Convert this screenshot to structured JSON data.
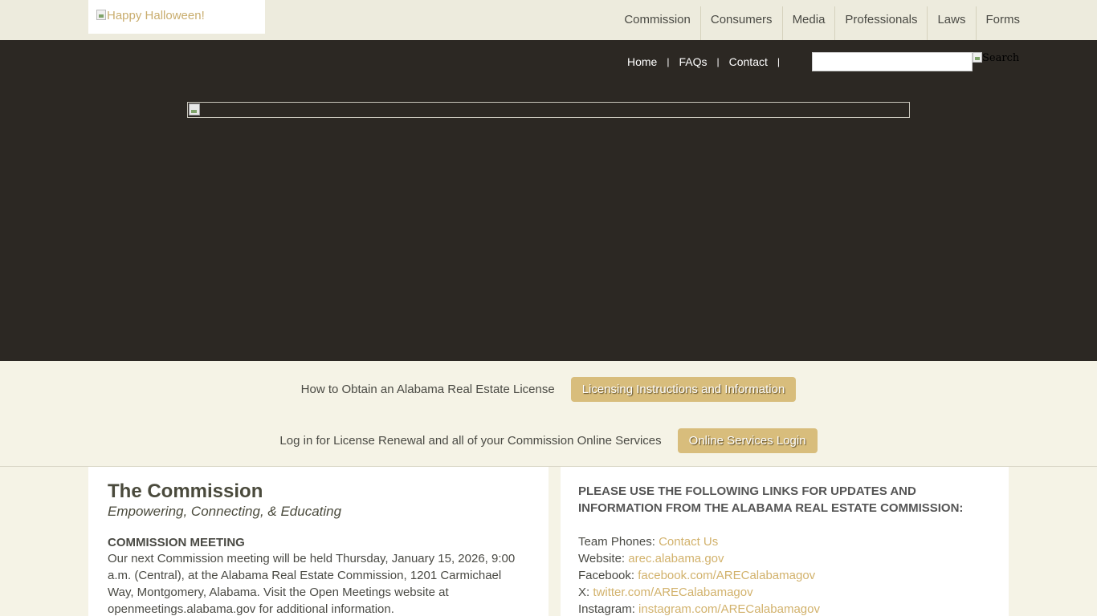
{
  "header": {
    "logo_alt": "Happy Halloween!",
    "nav": [
      "Commission",
      "Consumers",
      "Media",
      "Professionals",
      "Laws",
      "Forms"
    ]
  },
  "utility_nav": {
    "home": "Home",
    "faqs": "FAQs",
    "contact": "Contact",
    "separator": "|",
    "search_value": "",
    "search_button_alt": "Search"
  },
  "cta": {
    "license_text": "How to Obtain an Alabama Real Estate License",
    "license_button": "Licensing Instructions and Information",
    "login_text": "Log in for License Renewal and all of your Commission Online Services",
    "login_button": "Online Services Login"
  },
  "commission": {
    "title": "The Commission",
    "tagline": "Empowering, Connecting, & Educating",
    "meeting_heading": "COMMISSION MEETING",
    "meeting_body": "Our next Commission meeting will be held Thursday, January 15, 2026, 9:00 a.m. (Central), at the Alabama Real Estate Commission, 1201 Carmichael Way, Montgomery, Alabama. Visit the Open Meetings website at openmeetings.alabama.gov for additional information."
  },
  "updates": {
    "heading": "PLEASE USE THE FOLLOWING LINKS FOR UPDATES AND INFORMATION FROM THE ALABAMA REAL ESTATE COMMISSION:",
    "items": [
      {
        "label": "Team Phones:",
        "link": "Contact Us"
      },
      {
        "label": "Website:",
        "link": "arec.alabama.gov"
      },
      {
        "label": "Facebook:",
        "link": "facebook.com/ARECalabamagov"
      },
      {
        "label": "X:",
        "link": "twitter.com/ARECalabamagov"
      },
      {
        "label": "Instagram:",
        "link": "instagram.com/ARECalabamagov"
      }
    ]
  },
  "colors": {
    "header_bg": "#edebdd",
    "hero_bg": "#2c2823",
    "page_bg": "#f5f3e6",
    "accent_gold": "#d8bd7c",
    "link_gold": "#d2b26c"
  },
  "icons": [
    "broken-image-icon"
  ]
}
